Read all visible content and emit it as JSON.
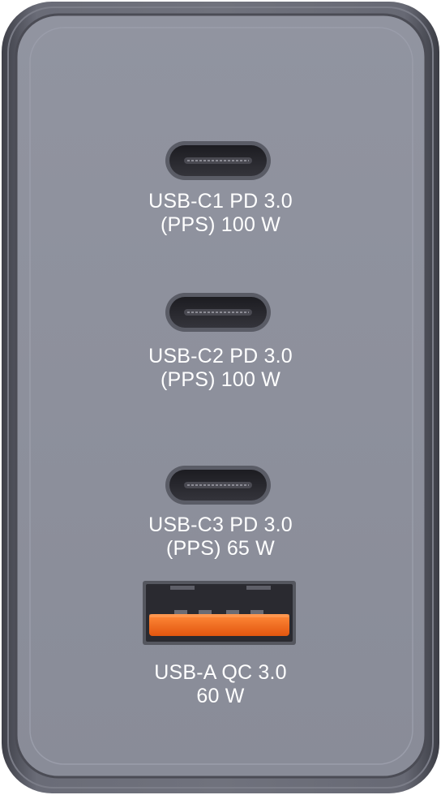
{
  "ports": [
    {
      "line1": "USB-C1 PD 3.0",
      "line2": "(PPS) 100 W",
      "type": "usb-c"
    },
    {
      "line1": "USB-C2 PD 3.0",
      "line2": "(PPS) 100 W",
      "type": "usb-c"
    },
    {
      "line1": "USB-C3 PD 3.0",
      "line2": "(PPS) 65 W",
      "type": "usb-c"
    },
    {
      "line1": "USB-A QC 3.0",
      "line2": "60 W",
      "type": "usb-a"
    }
  ],
  "colors": {
    "housing_outer": "#5c5e69",
    "face": "#8d909d",
    "port_slot": "#2a2a30",
    "usb_a_tongue": "#f26b1d",
    "label_text": "#ffffff"
  }
}
